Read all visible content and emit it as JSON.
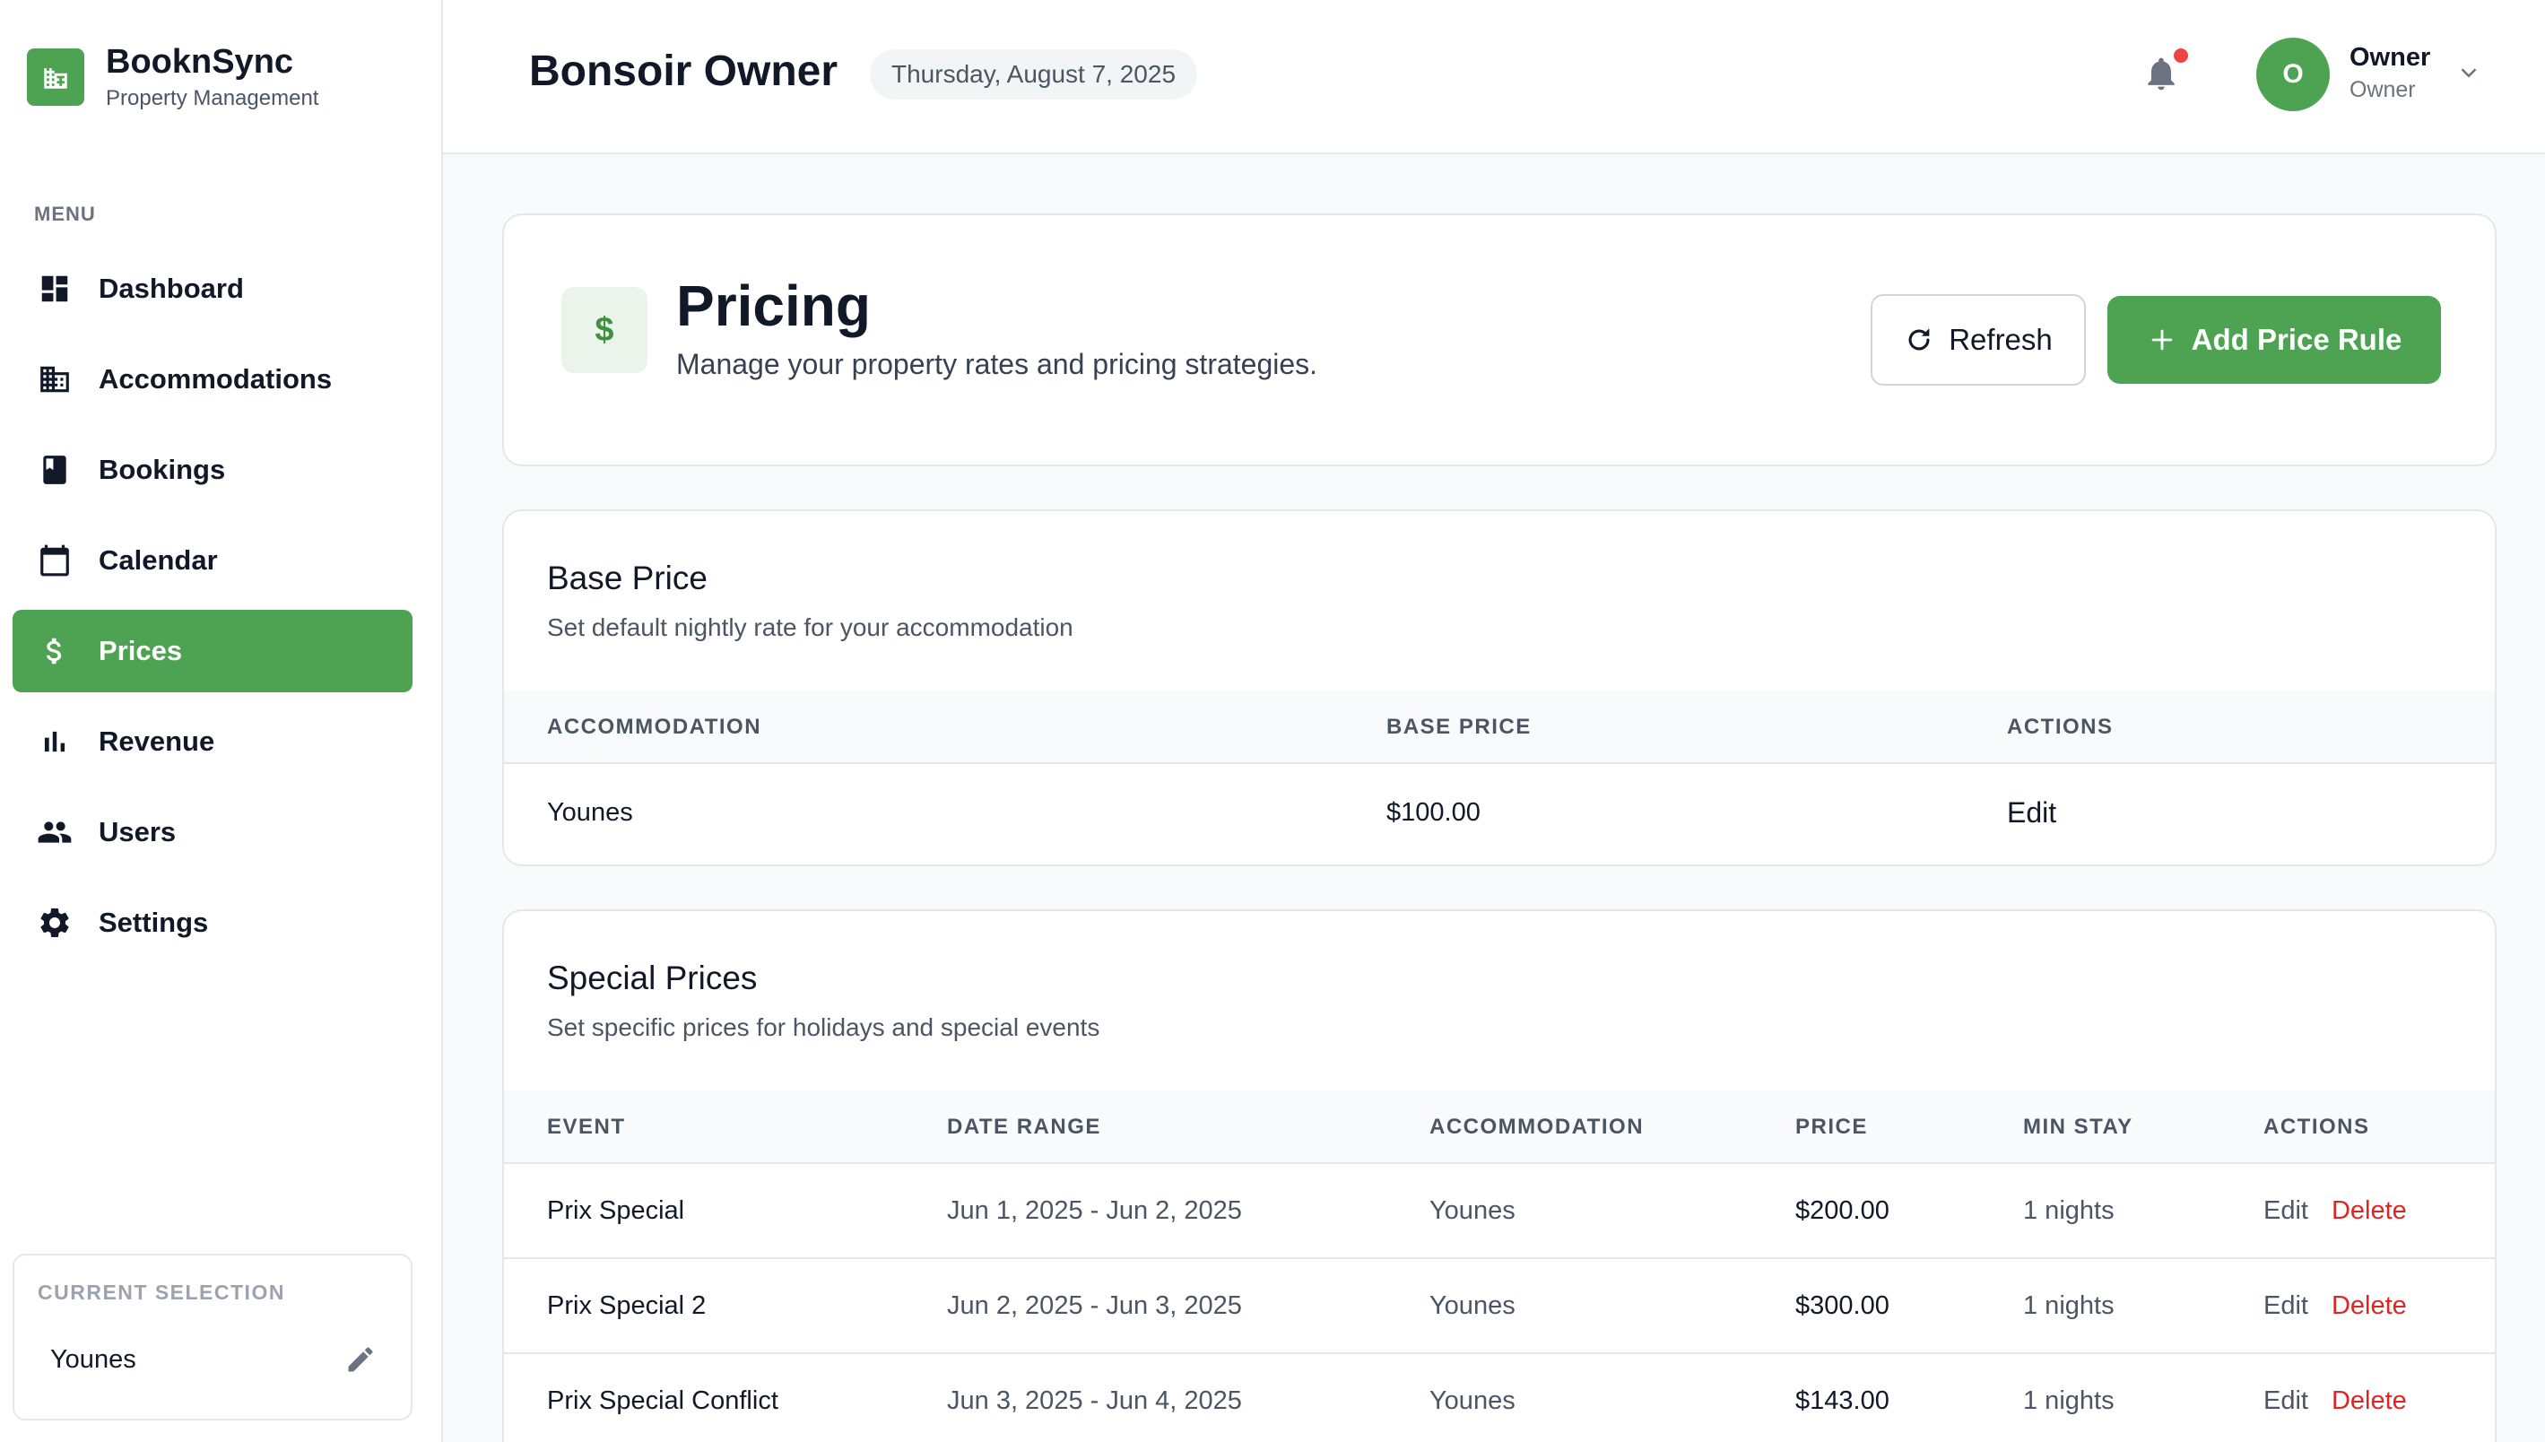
{
  "brand": {
    "name": "BooknSync",
    "subtitle": "Property Management"
  },
  "sidebar": {
    "menu_label": "MENU",
    "items": [
      {
        "label": "Dashboard",
        "icon": "dashboard-icon"
      },
      {
        "label": "Accommodations",
        "icon": "building-icon"
      },
      {
        "label": "Bookings",
        "icon": "book-icon"
      },
      {
        "label": "Calendar",
        "icon": "calendar-icon"
      },
      {
        "label": "Prices",
        "icon": "dollar-icon",
        "active": true
      },
      {
        "label": "Revenue",
        "icon": "bar-chart-icon"
      },
      {
        "label": "Users",
        "icon": "users-icon"
      },
      {
        "label": "Settings",
        "icon": "gear-icon"
      }
    ],
    "current_selection": {
      "title": "CURRENT SELECTION",
      "value": "Younes"
    }
  },
  "header": {
    "greeting": "Bonsoir Owner",
    "date": "Thursday, August 7, 2025",
    "user": {
      "initial": "O",
      "name": "Owner",
      "role": "Owner"
    }
  },
  "page": {
    "icon_glyph": "$",
    "title": "Pricing",
    "subtitle": "Manage your property rates and pricing strategies.",
    "refresh_label": "Refresh",
    "add_label": "Add Price Rule"
  },
  "base_price": {
    "title": "Base Price",
    "subtitle": "Set default nightly rate for your accommodation",
    "columns": [
      "ACCOMMODATION",
      "BASE PRICE",
      "ACTIONS"
    ],
    "rows": [
      {
        "accommodation": "Younes",
        "price": "$100.00",
        "action": "Edit"
      }
    ]
  },
  "special_prices": {
    "title": "Special Prices",
    "subtitle": "Set specific prices for holidays and special events",
    "columns": [
      "EVENT",
      "DATE RANGE",
      "ACCOMMODATION",
      "PRICE",
      "MIN STAY",
      "ACTIONS"
    ],
    "rows": [
      {
        "event": "Prix Special",
        "range": "Jun 1, 2025 - Jun 2, 2025",
        "accommodation": "Younes",
        "price": "$200.00",
        "min_stay": "1 nights",
        "edit": "Edit",
        "delete": "Delete"
      },
      {
        "event": "Prix Special 2",
        "range": "Jun 2, 2025 - Jun 3, 2025",
        "accommodation": "Younes",
        "price": "$300.00",
        "min_stay": "1 nights",
        "edit": "Edit",
        "delete": "Delete"
      },
      {
        "event": "Prix Special Conflict",
        "range": "Jun 3, 2025 - Jun 4, 2025",
        "accommodation": "Younes",
        "price": "$143.00",
        "min_stay": "1 nights",
        "edit": "Edit",
        "delete": "Delete"
      }
    ]
  },
  "colors": {
    "accent": "#4ea352",
    "danger": "#dc2626",
    "notification": "#ef4444"
  }
}
